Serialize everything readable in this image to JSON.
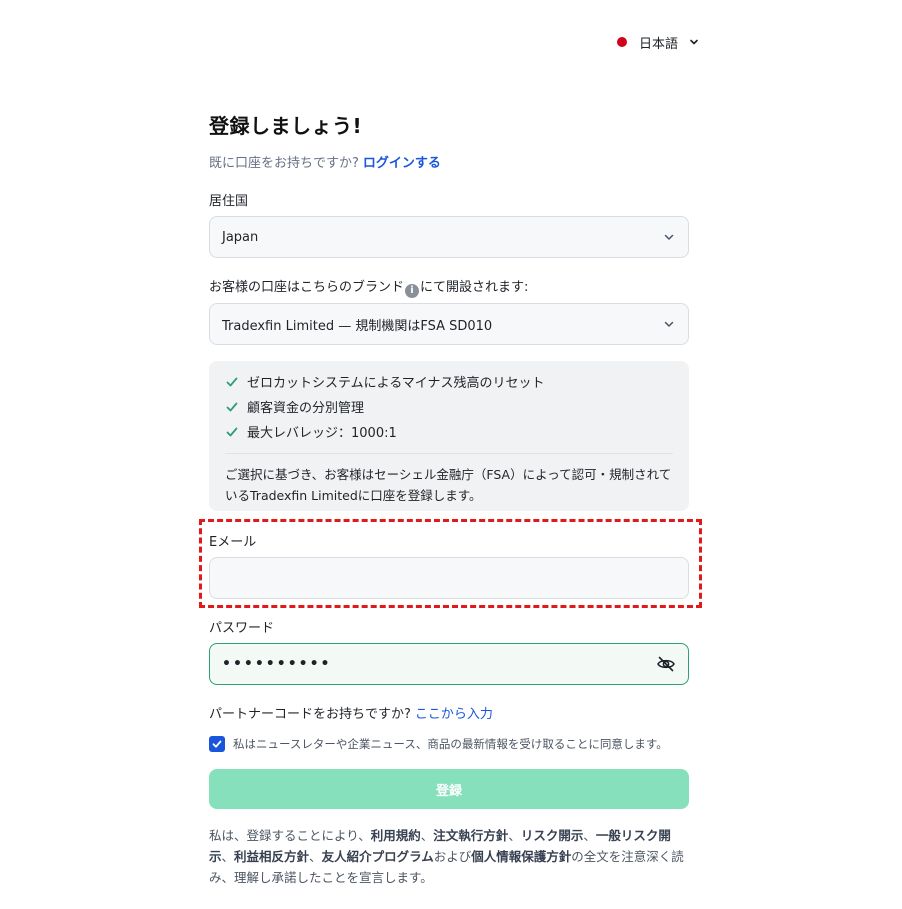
{
  "language": {
    "label": "日本語",
    "flag_color": "#d0021b"
  },
  "header": {
    "title": "登録しましょう!",
    "have_account": "既に口座をお持ちですか?",
    "login_link": "ログインする"
  },
  "country": {
    "label": "居住国",
    "value": "Japan"
  },
  "brand": {
    "label_before": "お客様の口座はこちらのブランド",
    "label_after": "にて開設されます:",
    "value": "Tradexfin Limited — 規制機関はFSA SD010"
  },
  "features": {
    "items": [
      "ゼロカットシステムによるマイナス残高のリセット",
      "顧客資金の分別管理",
      "最大レバレッジ：1000:1"
    ],
    "note": "ご選択に基づき、お客様はセーシェル金融庁（FSA）によって認可・規制されているTradexfin Limitedに口座を登録します。"
  },
  "email": {
    "label": "Eメール",
    "value": ""
  },
  "password": {
    "label": "パスワード",
    "masked_value": "••••••••••"
  },
  "partner": {
    "question": "パートナーコードをお持ちですか?",
    "link": "ここから入力"
  },
  "newsletter": {
    "checked": true,
    "text": "私はニュースレターや企業ニュース、商品の最新情報を受け取ることに同意します。"
  },
  "submit": {
    "label": "登録"
  },
  "terms": {
    "t1": "私は、登録することにより、",
    "l1": "利用規約",
    "s1": "、",
    "l2": "注文執行方針",
    "s2": "、",
    "l3": "リスク開示",
    "s3": "、",
    "l4": "一般リスク開示",
    "s4": "、",
    "l5": "利益相反方針",
    "s5": "、",
    "l6": "友人紹介プログラム",
    "s6": "および",
    "l7": "個人情報保護方針",
    "t2": "の全文を注意深く読み、理解し承諾したことを宣言します。"
  },
  "colors": {
    "link": "#1a56db",
    "check": "#2f9e70",
    "submit_bg": "#86e0bb",
    "highlight": "#e01a1a"
  }
}
